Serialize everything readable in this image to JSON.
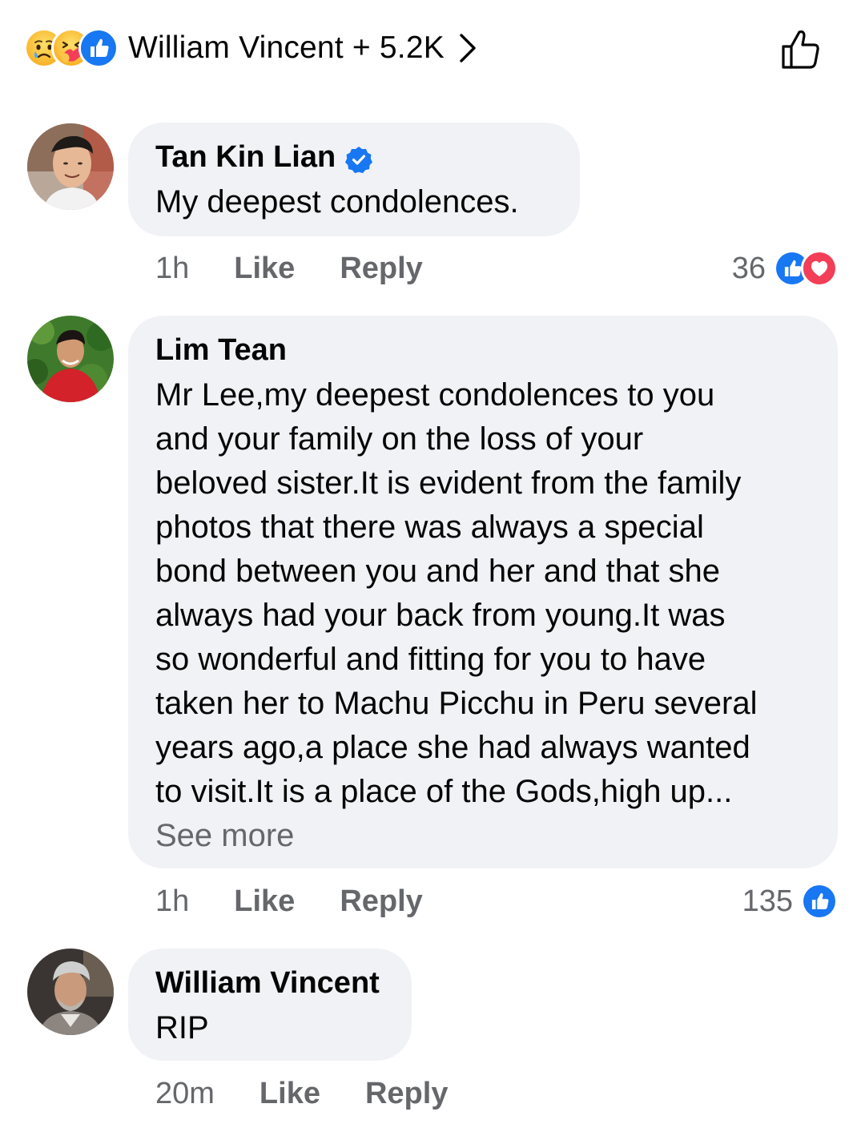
{
  "reactions_summary": {
    "icons": [
      "sad-face-icon",
      "care-hug-icon",
      "like-icon"
    ],
    "text": "William Vincent + 5.2K",
    "chevron": "chevron-right-icon",
    "like_action_icon": "like-outline-icon"
  },
  "comments": [
    {
      "author": "Tan Kin Lian",
      "verified": true,
      "text": "My deepest condolences.",
      "time": "1h",
      "like_label": "Like",
      "reply_label": "Reply",
      "reaction_count": "36",
      "reaction_icons": [
        "like-icon",
        "love-icon"
      ]
    },
    {
      "author": "Lim Tean",
      "verified": false,
      "text": "Mr Lee,my deepest condolences to you\nand your family on the loss of your\nbeloved sister.It is evident from the family\nphotos that there was always a special\nbond between you and her and that she\nalways had your back from young.It was\nso wonderful and fitting for you to have\ntaken her to Machu Picchu in Peru several\nyears ago,a place she had always wanted\nto visit.It is a place of the Gods,high up...",
      "see_more": "See more",
      "time": "1h",
      "like_label": "Like",
      "reply_label": "Reply",
      "reaction_count": "135",
      "reaction_icons": [
        "like-icon"
      ]
    },
    {
      "author": "William Vincent",
      "verified": false,
      "text": "RIP",
      "time": "20m",
      "like_label": "Like",
      "reply_label": "Reply"
    }
  ],
  "colors": {
    "like_blue": "#1877f2",
    "love_red": "#f33e58",
    "bubble_bg": "#f0f2f5",
    "secondary_text": "#65676b",
    "primary_text": "#050505"
  }
}
